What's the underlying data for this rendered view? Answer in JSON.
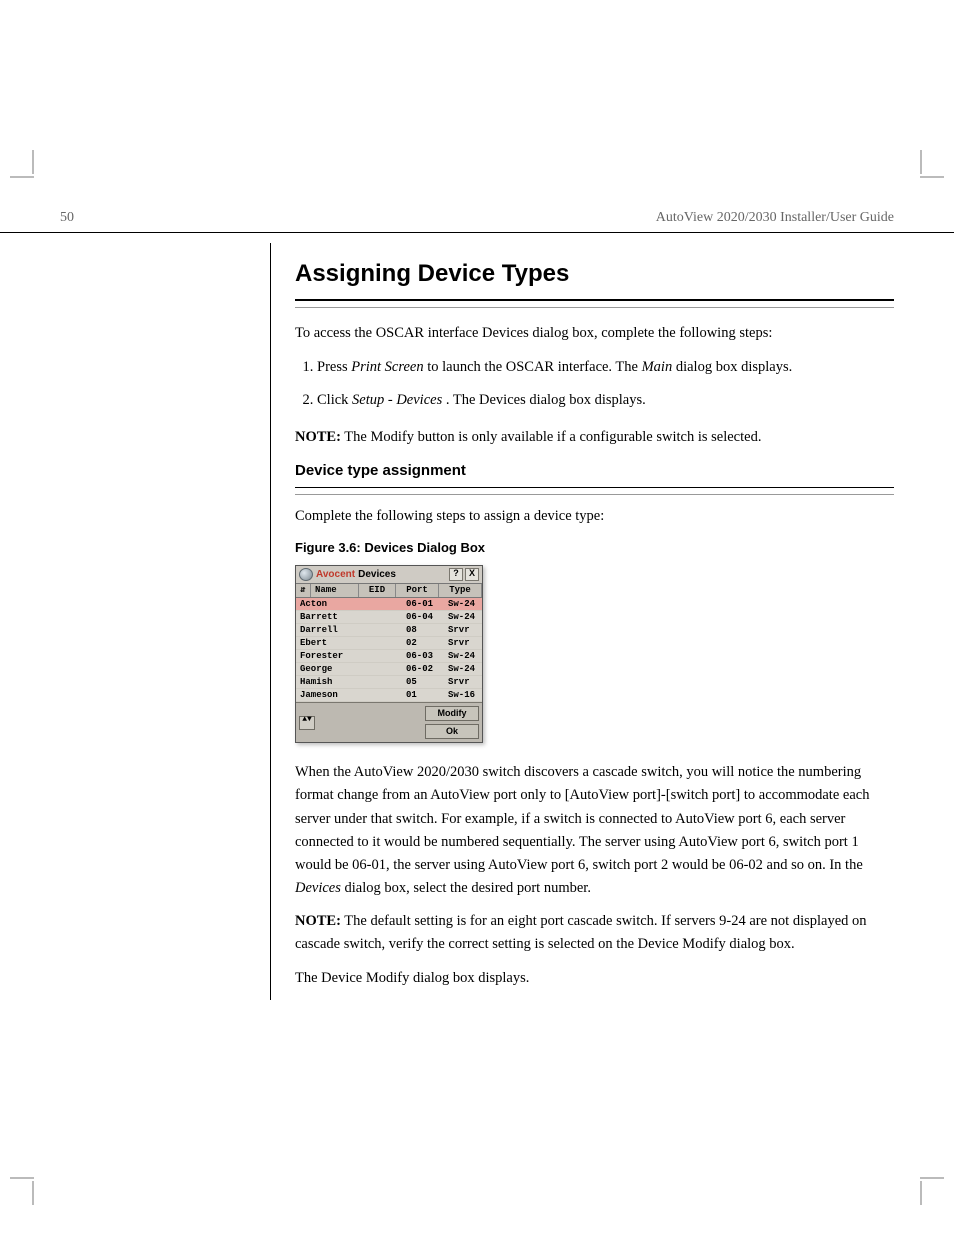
{
  "header": {
    "left": "50",
    "right": "AutoView 2020/2030 Installer/User Guide"
  },
  "section": {
    "heading": "Assigning Device Types",
    "intro": "To access the OSCAR interface Devices dialog box, complete the following steps:",
    "steps": [
      {
        "pre": "Press ",
        "em1": "Print Screen",
        "mid": " to launch the OSCAR interface. The ",
        "em2": "Main",
        "post": " dialog box displays."
      },
      {
        "pre": "Click ",
        "em1": "Setup - Devices",
        "post": ". The Devices dialog box displays."
      }
    ],
    "note": {
      "label": "NOTE:",
      "text": " The Modify button is only available if a configurable switch is selected."
    }
  },
  "sub": {
    "heading": "Device type assignment",
    "intro": "Complete the following steps to assign a device type:"
  },
  "figure": {
    "caption": "Figure 3.6: Devices Dialog Box"
  },
  "dialog": {
    "brand": "Avocent",
    "title": "Devices",
    "help_glyph": "?",
    "close_glyph": "X",
    "sort_glyph": "⇵",
    "spin_glyph": "▲▼",
    "cols": [
      "Name",
      "EID",
      "Port",
      "Type"
    ],
    "rows": [
      {
        "name": "Acton",
        "port": "06-01",
        "type": "Sw-24"
      },
      {
        "name": "Barrett",
        "port": "06-04",
        "type": "Sw-24"
      },
      {
        "name": "Darrell",
        "port": "08",
        "type": "Srvr"
      },
      {
        "name": "Ebert",
        "port": "02",
        "type": "Srvr"
      },
      {
        "name": "Forester",
        "port": "06-03",
        "type": "Sw-24"
      },
      {
        "name": "George",
        "port": "06-02",
        "type": "Sw-24"
      },
      {
        "name": "Hamish",
        "port": "05",
        "type": "Srvr"
      },
      {
        "name": "Jameson",
        "port": "01",
        "type": "Sw-16"
      }
    ],
    "buttons": [
      "Modify",
      "Ok"
    ]
  },
  "post": {
    "p1a": "When the AutoView 2020/2030 switch discovers a cascade switch, you will notice the numbering format change from an AutoView port only to [AutoView port]-[switch port] to accommodate each server under that switch. For example, if a switch is connected to AutoView port 6, each server connected to it would be numbered sequentially. The server using AutoView port 6, switch port 1 would be 06-01, the server using AutoView port 6, switch port 2 would be 06-02 and so on. In the ",
    "p1em": "Devices",
    "p1b": " dialog box, select the desired port number.",
    "note": {
      "label": "NOTE:",
      "text": " The default setting is for an eight port cascade switch. If servers 9-24 are not displayed on cascade switch, verify the correct setting is selected on the Device Modify dialog box."
    },
    "p2": "The Device Modify dialog box displays."
  }
}
